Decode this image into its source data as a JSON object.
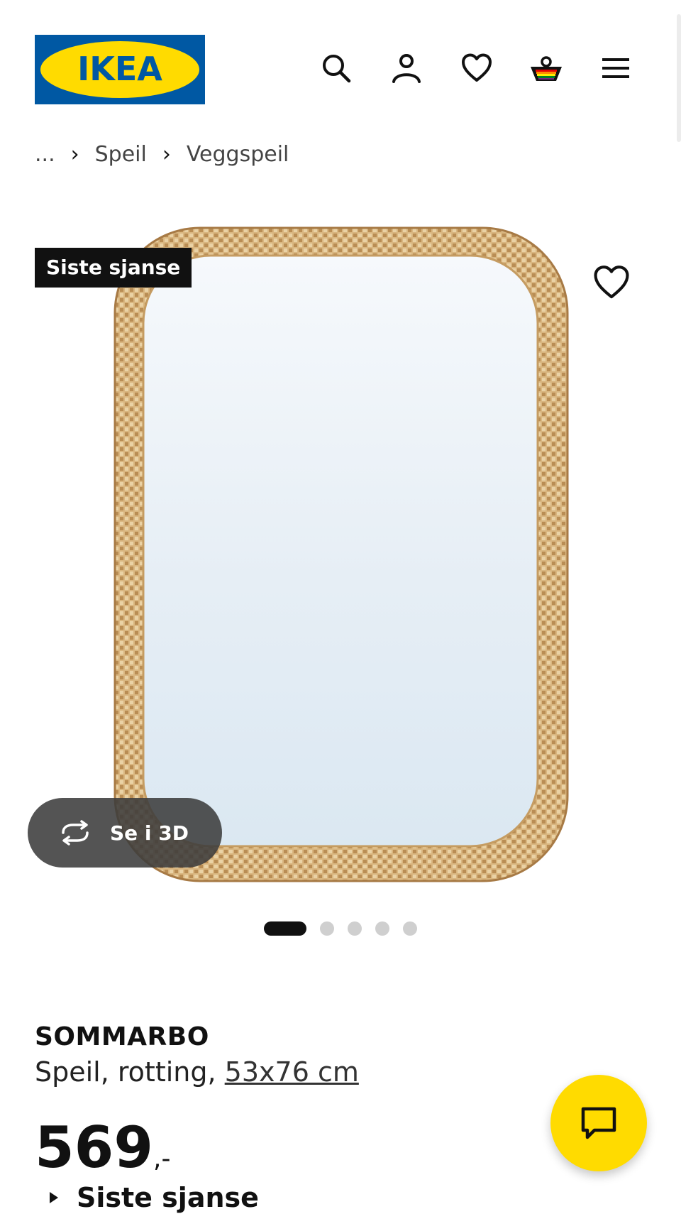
{
  "header": {
    "logo_text": "IKEA",
    "icons": [
      "search-icon",
      "account-icon",
      "heart-icon",
      "shopping-basket-icon",
      "hamburger-menu-icon"
    ]
  },
  "breadcrumb": {
    "ellipsis": "...",
    "items": [
      "Speil",
      "Veggspeil"
    ]
  },
  "gallery": {
    "badge": "Siste sjanse",
    "see_3d_label": "Se i 3D",
    "dot_count": 5,
    "active_dot": 1
  },
  "product": {
    "name": "SOMMARBO",
    "description": "Speil, rotting,",
    "size": "53x76 cm",
    "price": "569",
    "price_suffix": ",-",
    "availability_label": "Siste sjanse"
  },
  "colors": {
    "ikea_blue": "#0058a3",
    "ikea_yellow": "#ffdb00",
    "badge_bg": "#111111"
  }
}
